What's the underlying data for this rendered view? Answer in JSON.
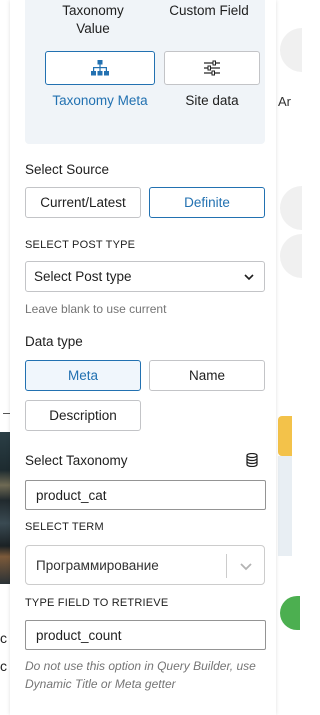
{
  "background": {
    "left_chars": [
      "c",
      "c"
    ],
    "right_text": "Ar"
  },
  "source_options": {
    "taxonomy_value": "Taxonomy Value",
    "custom_field": "Custom Field",
    "taxonomy_meta": "Taxonomy Meta",
    "site_data": "Site data",
    "selected": "Taxonomy Meta",
    "icons": {
      "taxonomy_meta": "hierarchy-icon",
      "site_data": "sliders-icon"
    }
  },
  "select_source": {
    "label": "Select Source",
    "options": [
      "Current/Latest",
      "Definite"
    ],
    "selected": "Definite"
  },
  "post_type": {
    "label": "SELECT POST TYPE",
    "value": "Select Post type",
    "help": "Leave blank to use current"
  },
  "data_type": {
    "label": "Data type",
    "options": [
      "Meta",
      "Name",
      "Description"
    ],
    "selected": "Meta"
  },
  "taxonomy": {
    "label": "Select Taxonomy",
    "icon": "database-icon",
    "value": "product_cat"
  },
  "term": {
    "label": "SELECT TERM",
    "value": "Программирование"
  },
  "retrieve_field": {
    "label": "TYPE FIELD TO RETRIEVE",
    "value": "product_count",
    "help": "Do not use this option in Query Builder, use Dynamic Title or Meta getter"
  },
  "colors": {
    "accent": "#2271b1",
    "panel_bg": "#f0f4f8",
    "border": "#c3c4c7"
  }
}
